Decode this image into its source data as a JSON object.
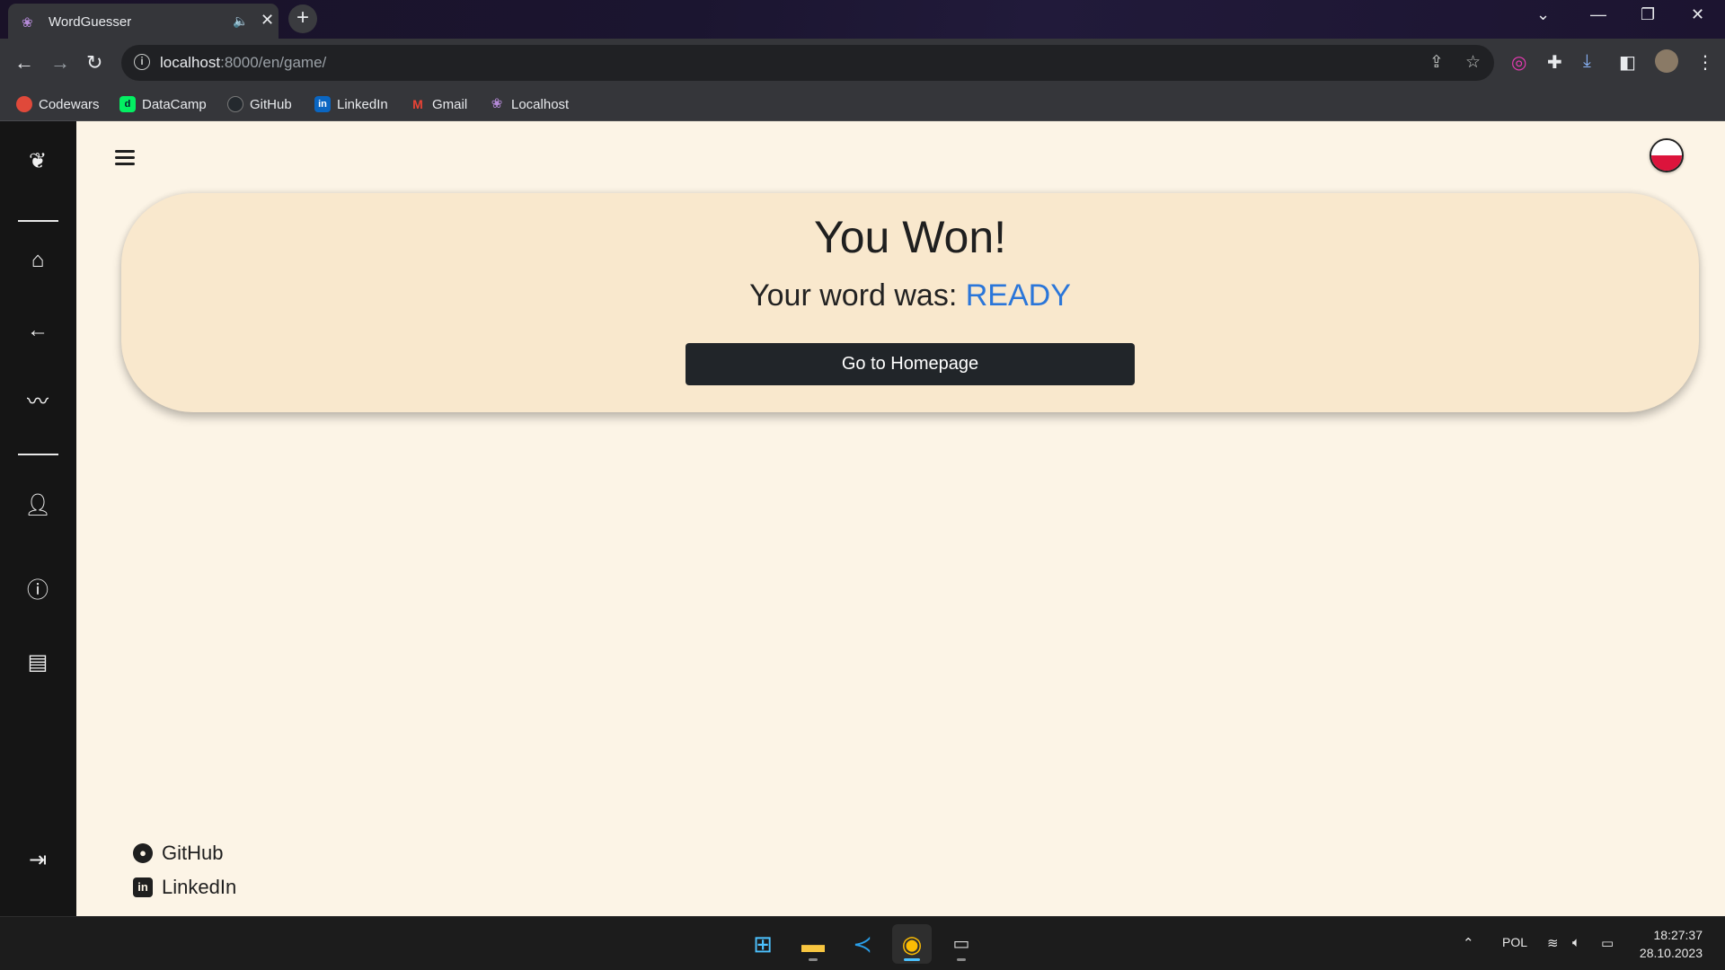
{
  "browser": {
    "tab_title": "WordGuesser",
    "url_host": "localhost",
    "url_path": ":8000/en/game/",
    "bookmarks": [
      {
        "label": "Codewars",
        "color": "#e0493a"
      },
      {
        "label": "DataCamp",
        "color": "#03ef62"
      },
      {
        "label": "GitHub",
        "color": "#24292e"
      },
      {
        "label": "LinkedIn",
        "color": "#0a66c2"
      },
      {
        "label": "Gmail",
        "color": "#ea4335"
      },
      {
        "label": "Localhost",
        "color": "#b58ad8"
      }
    ]
  },
  "game": {
    "title": "You Won!",
    "subtitle_prefix": "Your word was:",
    "word": "READY",
    "home_button": "Go to Homepage"
  },
  "footer": {
    "github": "GitHub",
    "linkedin": "LinkedIn"
  },
  "taskbar": {
    "language": "POL",
    "time": "18:27:37",
    "date": "28.10.2023"
  },
  "colors": {
    "page_bg": "#fcf4e6",
    "card_bg": "#f9e8cd",
    "accent_word": "#2b76d9",
    "sidebar_bg": "#151515",
    "button_bg": "#212529"
  }
}
